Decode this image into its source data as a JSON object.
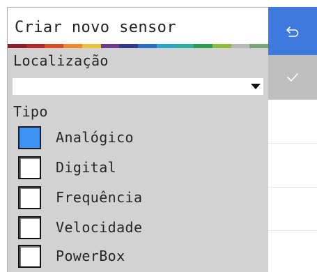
{
  "dialog": {
    "title": "Criar novo sensor",
    "location_label": "Localização",
    "location_value": "",
    "type_label": "Tipo",
    "options": [
      {
        "label": "Analógico",
        "checked": true
      },
      {
        "label": "Digital",
        "checked": false
      },
      {
        "label": "Frequência",
        "checked": false
      },
      {
        "label": "Velocidade",
        "checked": false
      },
      {
        "label": "PowerBox",
        "checked": false
      }
    ]
  },
  "actions": {
    "undo_icon": "undo-arrow-icon",
    "confirm_icon": "checkmark-icon"
  },
  "colors": {
    "accent_blue": "#3e79de",
    "checked_blue": "#3c93f5",
    "panel_gray": "#d2d2d2",
    "confirm_gray": "#bfbfbf",
    "rainbow": [
      "#8b1f2a",
      "#b3262c",
      "#d94c2a",
      "#f08a2a",
      "#e8c23a",
      "#6a3c8e",
      "#2d3a8c",
      "#2b6cc4",
      "#2aa6c9",
      "#2ab0a0",
      "#2f9b4f",
      "#8dbb3e",
      "#b8b8b8",
      "#7aa37a"
    ]
  }
}
